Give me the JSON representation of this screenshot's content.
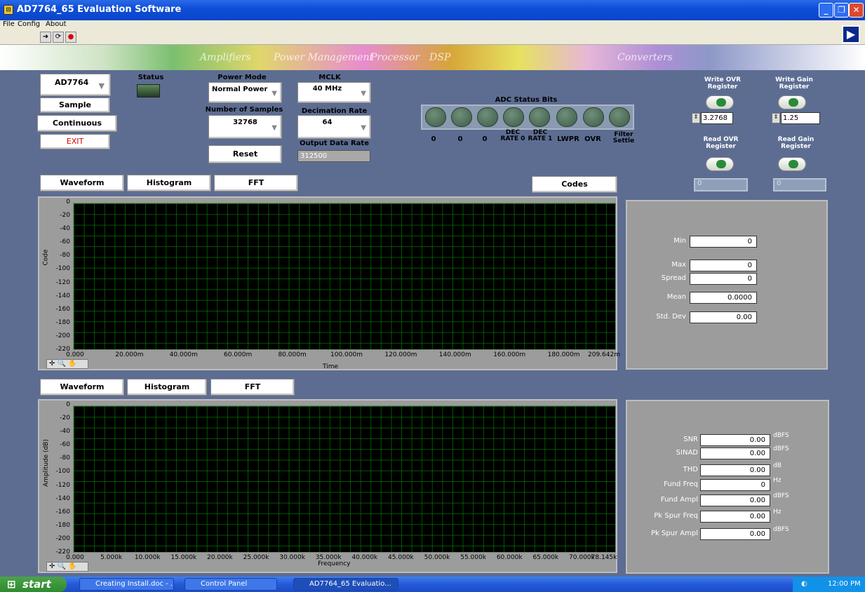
{
  "window": {
    "title": "AD7764_65 Evaluation Software",
    "icon_text": "⊡"
  },
  "menu": [
    "File",
    "Config",
    "About"
  ],
  "banner_words": [
    "Amplifiers",
    "Power Management",
    "Processor",
    "DSP",
    "Converters"
  ],
  "controls": {
    "device_select": "AD7764",
    "sample_button": "Sample",
    "continuous_button": "Continuous",
    "exit_button": "EXIT",
    "status_label": "Status",
    "power_mode_label": "Power Mode",
    "power_mode_value": "Normal Power",
    "num_samples_label": "Number of Samples",
    "num_samples_value": "32768",
    "reset_button": "Reset",
    "mclk_label": "MCLK",
    "mclk_value": "40 MHz",
    "decimation_label": "Decimation Rate",
    "decimation_value": "64",
    "output_rate_label": "Output Data Rate",
    "output_rate_value": "312500"
  },
  "status_bits": {
    "title": "ADC Status Bits",
    "labels": [
      "0",
      "0",
      "0",
      "DEC RATE 0",
      "DEC RATE 1",
      "LWPR",
      "OVR",
      "Filter Settle"
    ]
  },
  "registers": {
    "write_ovr_label": "Write OVR Register",
    "write_ovr_value": "3.2768",
    "write_gain_label": "Write Gain Register",
    "write_gain_value": "1.25",
    "read_ovr_label": "Read OVR Register",
    "read_ovr_value": "0",
    "read_gain_label": "Read Gain Register",
    "read_gain_value": "0"
  },
  "top_tabs": [
    "Waveform",
    "Histogram",
    "FFT"
  ],
  "codes_button": "Codes",
  "top_plot": {
    "ylabel": "Code",
    "xlabel": "Time",
    "yticks": [
      "0",
      "-20",
      "-40",
      "-60",
      "-80",
      "-100",
      "-120",
      "-140",
      "-160",
      "-180",
      "-200",
      "-220"
    ],
    "xticks": [
      "0.000",
      "20.000m",
      "40.000m",
      "60.000m",
      "80.000m",
      "100.000m",
      "120.000m",
      "140.000m",
      "160.000m",
      "180.000m",
      "209.642m"
    ]
  },
  "top_stats": [
    {
      "label": "Min",
      "value": "0"
    },
    {
      "label": "Max",
      "value": "0"
    },
    {
      "label": "Spread",
      "value": "0"
    },
    {
      "label": "Mean",
      "value": "0.0000"
    },
    {
      "label": "Std. Dev",
      "value": "0.00"
    }
  ],
  "bottom_tabs": [
    "Waveform",
    "Histogram",
    "FFT"
  ],
  "bottom_plot": {
    "ylabel": "Amplitude (dB)",
    "xlabel": "Frequency",
    "yticks": [
      "0",
      "-20",
      "-40",
      "-60",
      "-80",
      "-100",
      "-120",
      "-140",
      "-160",
      "-180",
      "-200",
      "-220"
    ],
    "xticks": [
      "0.000",
      "5.000k",
      "10.000k",
      "15.000k",
      "20.000k",
      "25.000k",
      "30.000k",
      "35.000k",
      "40.000k",
      "45.000k",
      "50.000k",
      "55.000k",
      "60.000k",
      "65.000k",
      "70.000k",
      "78.145k"
    ]
  },
  "fft_stats": [
    {
      "label": "SNR",
      "value": "0.00",
      "unit": "dBFS"
    },
    {
      "label": "SINAD",
      "value": "0.00",
      "unit": "dBFS"
    },
    {
      "label": "THD",
      "value": "0.00",
      "unit": "dB"
    },
    {
      "label": "Fund Freq",
      "value": "0",
      "unit": "Hz"
    },
    {
      "label": "Fund Ampl",
      "value": "0.00",
      "unit": "dBFS"
    },
    {
      "label": "Pk Spur Freq",
      "value": "0.00",
      "unit": "Hz"
    },
    {
      "label": "Pk Spur Ampl",
      "value": "0.00",
      "unit": "dBFS"
    }
  ],
  "taskbar": {
    "start": "start",
    "tasks": [
      "Creating Install.doc - ...",
      "Control Panel",
      "AD7764_65 Evaluatio..."
    ],
    "clock": "12:00 PM"
  }
}
